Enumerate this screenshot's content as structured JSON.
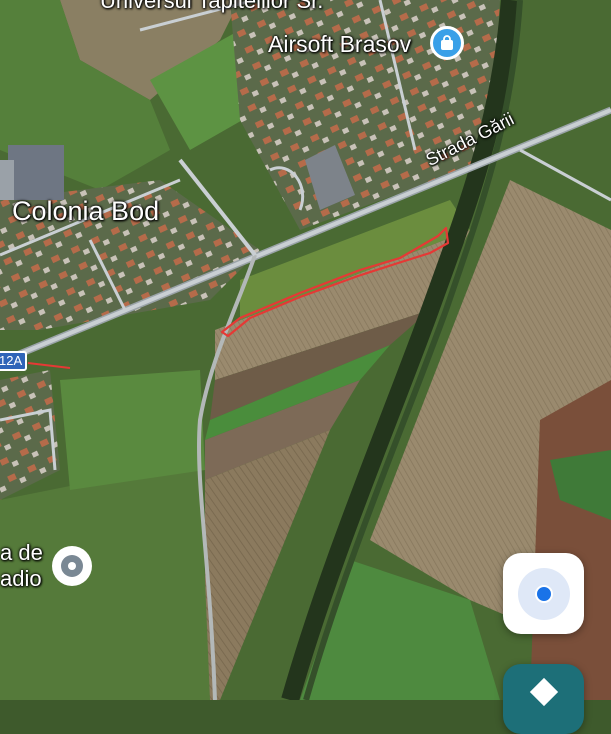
{
  "map": {
    "labels": {
      "top_partial": "Universul Tapitelilor Sr.",
      "airsoft": "Airsoft Brasov",
      "colonia": "Colonia Bod",
      "strada": "Strada Gării",
      "route": "12A",
      "place_line1": "a de",
      "place_line2": "adio"
    },
    "icons": {
      "poi": "shopping-bag-icon",
      "place": "place-pin-icon",
      "location": "my-location-icon",
      "directions": "directions-icon"
    },
    "colors": {
      "poi_pin": "#3aa0e8",
      "highlight_outline": "#e53935",
      "route_shield": "#2f64b8",
      "location_dot": "#1a73e8"
    }
  }
}
